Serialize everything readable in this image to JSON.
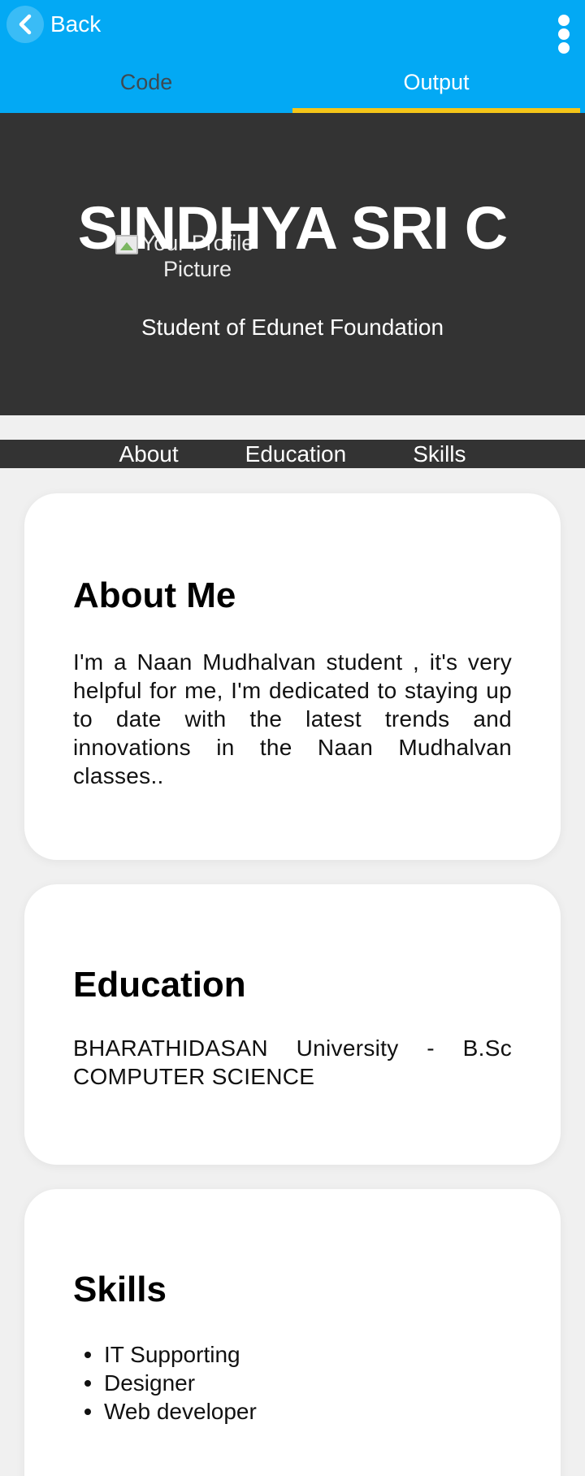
{
  "appbar": {
    "back_label": "Back",
    "tabs": [
      {
        "label": "Code",
        "active": false
      },
      {
        "label": "Output",
        "active": true
      }
    ],
    "colors": {
      "bar": "#03a9f4",
      "indicator": "#f5c518"
    }
  },
  "hero": {
    "name": "SINDHYA SRI C",
    "image_alt": "Your Profile Picture",
    "subtitle": "Student of Edunet Foundation"
  },
  "nav": {
    "items": [
      "About",
      "Education",
      "Skills"
    ]
  },
  "about": {
    "title": "About Me",
    "text": "I'm a Naan Mudhalvan student , it's very helpful for me, I'm dedicated to staying up to date with the latest trends and innovations in the Naan Mudhalvan classes.."
  },
  "education": {
    "title": "Education",
    "text": "BHARATHIDASAN University - B.Sc COMPUTER SCIENCE"
  },
  "skills": {
    "title": "Skills",
    "items": [
      "IT Supporting",
      "Designer",
      "Web developer"
    ]
  }
}
